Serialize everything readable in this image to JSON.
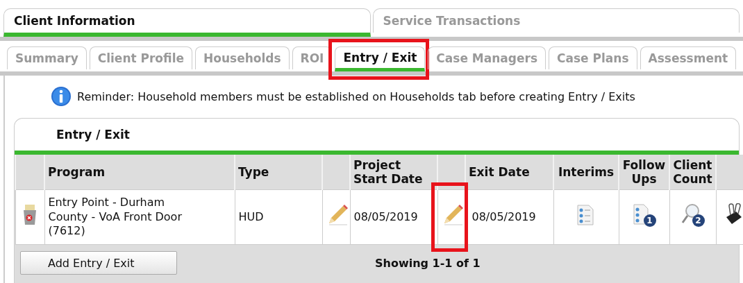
{
  "top_tabs": [
    {
      "label": "Client Information",
      "selected": true
    },
    {
      "label": "Service Transactions",
      "selected": false
    }
  ],
  "sub_tabs": [
    {
      "label": "Summary",
      "selected": false,
      "highlighted": false
    },
    {
      "label": "Client Profile",
      "selected": false,
      "highlighted": false
    },
    {
      "label": "Households",
      "selected": false,
      "highlighted": false
    },
    {
      "label": "ROI",
      "selected": false,
      "highlighted": false
    },
    {
      "label": "Entry / Exit",
      "selected": true,
      "highlighted": true
    },
    {
      "label": "Case Managers",
      "selected": false,
      "highlighted": false
    },
    {
      "label": "Case Plans",
      "selected": false,
      "highlighted": false
    },
    {
      "label": "Assessment",
      "selected": false,
      "highlighted": false
    }
  ],
  "reminder": "Reminder: Household members must be established on Households tab before creating Entry / Exits",
  "panel": {
    "title": "Entry / Exit",
    "table": {
      "columns": [
        "Program",
        "Type",
        "Project Start Date",
        "Exit Date",
        "Interims",
        "Follow Ups",
        "Client Count"
      ],
      "rows": [
        {
          "program": "Entry Point - Durham County - VoA Front Door (7612)",
          "type": "HUD",
          "start_date": "08/05/2019",
          "exit_date": "08/05/2019",
          "exit_edit_highlighted": true,
          "follow_ups_badge": "1",
          "client_count_badge": "2"
        }
      ]
    },
    "add_button": "Add Entry / Exit",
    "showing": "Showing 1-1 of 1"
  }
}
